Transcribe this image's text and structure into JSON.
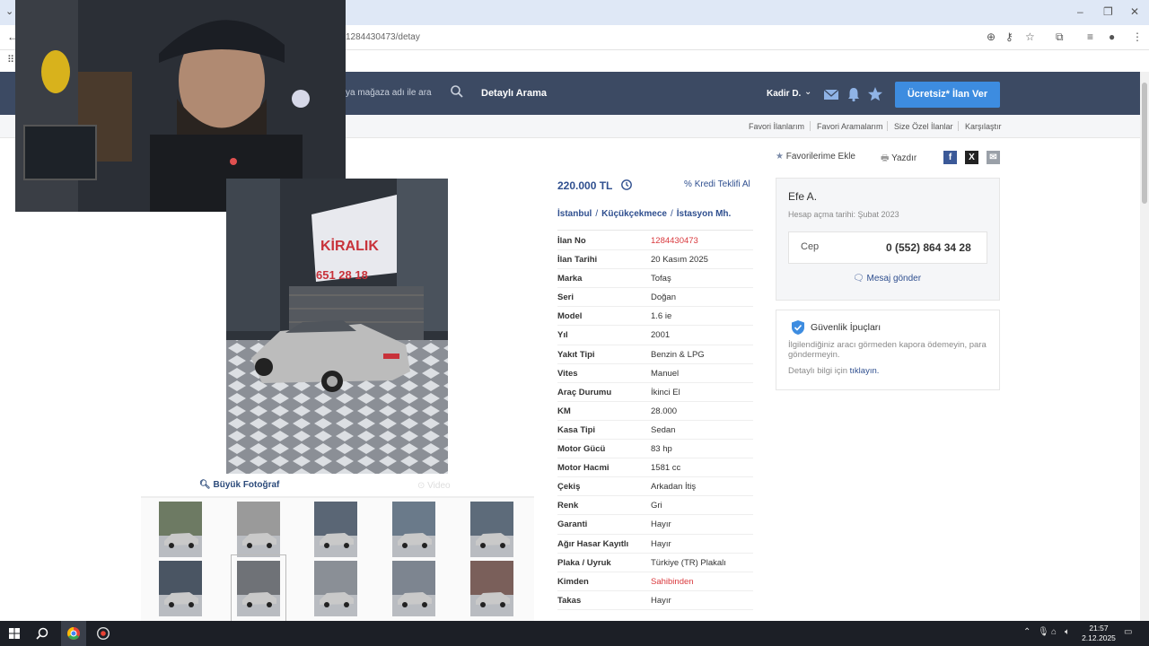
{
  "browser": {
    "url": "1284430473/detay"
  },
  "header": {
    "search_placeholder": "ya mağaza adı ile ara",
    "detailed_search": "Detaylı Arama",
    "user": "Kadir D.",
    "post_ad": "Ücretsiz* İlan Ver"
  },
  "subnav": [
    "Favori İlanlarım",
    "Favori Aramalarım",
    "Size Özel İlanlar",
    "Karşılaştır"
  ],
  "actions": {
    "favorite": "Favorilerime Ekle",
    "print": "Yazdır"
  },
  "photos": {
    "big_photo": "Büyük Fotoğraf",
    "video": "Video",
    "banner_text": "KİRALIK",
    "banner_phone": "651 28 18"
  },
  "listing": {
    "price": "220.000 TL",
    "credit": "Kredi Teklifi Al",
    "location": [
      "İstanbul",
      "Küçükçekmece",
      "İstasyon Mh."
    ],
    "specs": [
      {
        "label": "İlan No",
        "value": "1284430473"
      },
      {
        "label": "İlan Tarihi",
        "value": "20 Kasım 2025"
      },
      {
        "label": "Marka",
        "value": "Tofaş"
      },
      {
        "label": "Seri",
        "value": "Doğan"
      },
      {
        "label": "Model",
        "value": "1.6 ie"
      },
      {
        "label": "Yıl",
        "value": "2001"
      },
      {
        "label": "Yakıt Tipi",
        "value": "Benzin & LPG"
      },
      {
        "label": "Vites",
        "value": "Manuel"
      },
      {
        "label": "Araç Durumu",
        "value": "İkinci El"
      },
      {
        "label": "KM",
        "value": "28.000"
      },
      {
        "label": "Kasa Tipi",
        "value": "Sedan"
      },
      {
        "label": "Motor Gücü",
        "value": "83 hp"
      },
      {
        "label": "Motor Hacmi",
        "value": "1581 cc"
      },
      {
        "label": "Çekiş",
        "value": "Arkadan İtiş"
      },
      {
        "label": "Renk",
        "value": "Gri"
      },
      {
        "label": "Garanti",
        "value": "Hayır"
      },
      {
        "label": "Ağır Hasar Kayıtlı",
        "value": "Hayır"
      },
      {
        "label": "Plaka / Uyruk",
        "value": "Türkiye (TR) Plakalı"
      },
      {
        "label": "Kimden",
        "value": "Sahibinden"
      },
      {
        "label": "Takas",
        "value": "Hayır"
      }
    ]
  },
  "seller": {
    "name": "Efe A.",
    "since": "Hesap açma tarihi: Şubat 2023",
    "phone_label": "Cep",
    "phone": "0 (552) 864 34 28",
    "message": "Mesaj gönder"
  },
  "safety": {
    "title": "Güvenlik İpuçları",
    "text": "İlgilendiğiniz aracı görmeden kapora ödemeyin, para göndermeyin.",
    "more_prefix": "Detaylı bilgi için",
    "more_link": "tıklayın."
  },
  "taskbar": {
    "time": "21:57",
    "date": "2.12.2025"
  },
  "colors": {
    "header_bg": "#3c4a63",
    "accent_blue": "#3d8ce0",
    "link_blue": "#2f4f8f",
    "red_value": "#d9393d"
  }
}
